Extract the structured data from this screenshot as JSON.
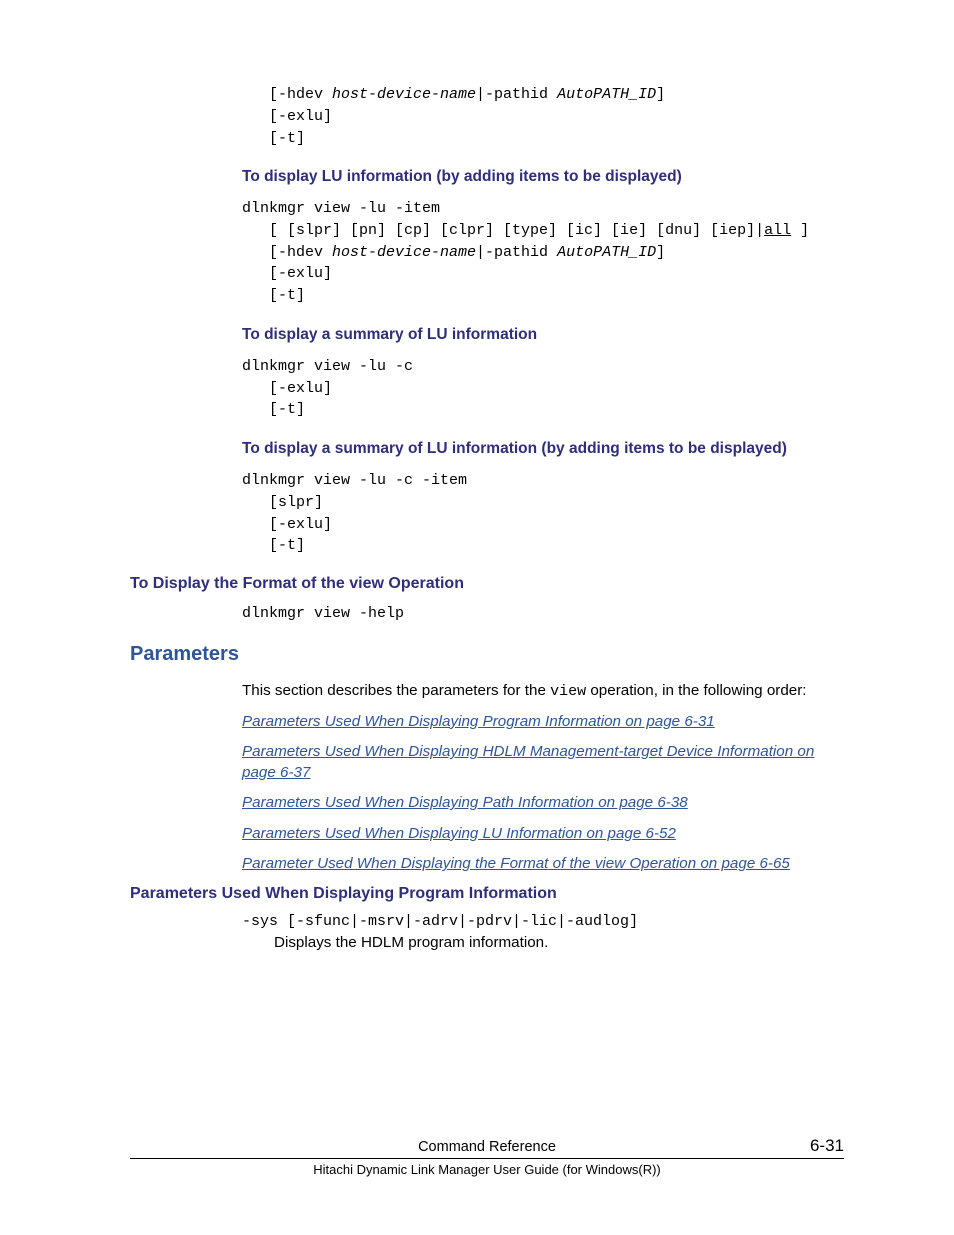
{
  "code1": {
    "l1a": "   [-hdev ",
    "l1b": "host-device-name",
    "l1c": "|-pathid ",
    "l1d": "AutoPATH_ID",
    "l1e": "]",
    "l2": "   [-exlu]",
    "l3": "   [-t]"
  },
  "sec1": {
    "heading": "To display LU information (by adding items to be displayed)",
    "l1": "dlnkmgr view -lu -item",
    "l2a": "   [ [slpr] [pn] [cp] [clpr] [type] [ic] [ie] [dnu] [iep]|",
    "l2b": "all",
    "l2c": " ]",
    "l3a": "   [-hdev ",
    "l3b": "host-device-name",
    "l3c": "|-pathid ",
    "l3d": "AutoPATH_ID",
    "l3e": "]",
    "l4": "   [-exlu]",
    "l5": "   [-t]"
  },
  "sec2": {
    "heading": "To display a summary of LU information",
    "l1": "dlnkmgr view -lu -c",
    "l2": "   [-exlu]",
    "l3": "   [-t]"
  },
  "sec3": {
    "heading": "To display a summary of LU information (by adding items to be displayed)",
    "l1": "dlnkmgr view -lu -c -item",
    "l2": "   [slpr]",
    "l3": "   [-exlu]",
    "l4": "   [-t]"
  },
  "sec4": {
    "heading": "To Display the Format of the view Operation",
    "l1": "dlnkmgr view -help"
  },
  "params": {
    "heading": "Parameters",
    "intro_a": "This section describes the parameters for the ",
    "intro_b": "view",
    "intro_c": " operation, in the following order:",
    "links": [
      "Parameters Used When Displaying Program Information on page 6-31",
      "Parameters Used When Displaying HDLM Management-target Device Information on page 6-37",
      "Parameters Used When Displaying Path Information on page 6-38",
      "Parameters Used When Displaying LU Information on page 6-52",
      "Parameter Used When Displaying the Format of the view Operation on page 6-65"
    ],
    "sub_heading": "Parameters Used When Displaying Program Information",
    "opt": "-sys [-sfunc|-msrv|-adrv|-pdrv|-lic|-audlog]",
    "opt_desc": "Displays the HDLM program information."
  },
  "footer": {
    "chapter": "Command Reference",
    "page": "6-31",
    "doc": "Hitachi Dynamic Link Manager User Guide (for Windows(R))"
  }
}
